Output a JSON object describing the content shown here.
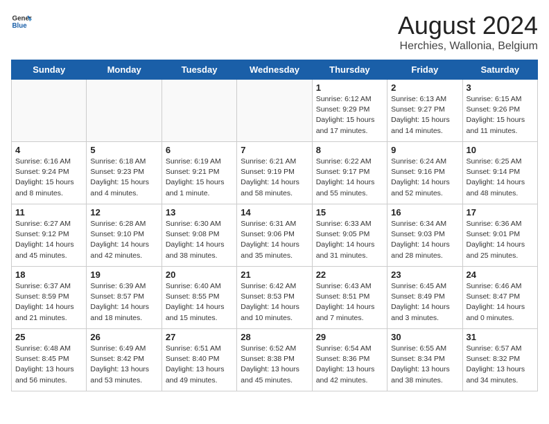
{
  "header": {
    "logo_line1": "General",
    "logo_line2": "Blue",
    "title": "August 2024",
    "subtitle": "Herchies, Wallonia, Belgium"
  },
  "weekdays": [
    "Sunday",
    "Monday",
    "Tuesday",
    "Wednesday",
    "Thursday",
    "Friday",
    "Saturday"
  ],
  "weeks": [
    [
      {
        "day": "",
        "empty": true
      },
      {
        "day": "",
        "empty": true
      },
      {
        "day": "",
        "empty": true
      },
      {
        "day": "",
        "empty": true
      },
      {
        "day": "1",
        "sunrise": "6:12 AM",
        "sunset": "9:29 PM",
        "daylight": "15 hours and 17 minutes."
      },
      {
        "day": "2",
        "sunrise": "6:13 AM",
        "sunset": "9:27 PM",
        "daylight": "15 hours and 14 minutes."
      },
      {
        "day": "3",
        "sunrise": "6:15 AM",
        "sunset": "9:26 PM",
        "daylight": "15 hours and 11 minutes."
      }
    ],
    [
      {
        "day": "4",
        "sunrise": "6:16 AM",
        "sunset": "9:24 PM",
        "daylight": "15 hours and 8 minutes."
      },
      {
        "day": "5",
        "sunrise": "6:18 AM",
        "sunset": "9:23 PM",
        "daylight": "15 hours and 4 minutes."
      },
      {
        "day": "6",
        "sunrise": "6:19 AM",
        "sunset": "9:21 PM",
        "daylight": "15 hours and 1 minute."
      },
      {
        "day": "7",
        "sunrise": "6:21 AM",
        "sunset": "9:19 PM",
        "daylight": "14 hours and 58 minutes."
      },
      {
        "day": "8",
        "sunrise": "6:22 AM",
        "sunset": "9:17 PM",
        "daylight": "14 hours and 55 minutes."
      },
      {
        "day": "9",
        "sunrise": "6:24 AM",
        "sunset": "9:16 PM",
        "daylight": "14 hours and 52 minutes."
      },
      {
        "day": "10",
        "sunrise": "6:25 AM",
        "sunset": "9:14 PM",
        "daylight": "14 hours and 48 minutes."
      }
    ],
    [
      {
        "day": "11",
        "sunrise": "6:27 AM",
        "sunset": "9:12 PM",
        "daylight": "14 hours and 45 minutes."
      },
      {
        "day": "12",
        "sunrise": "6:28 AM",
        "sunset": "9:10 PM",
        "daylight": "14 hours and 42 minutes."
      },
      {
        "day": "13",
        "sunrise": "6:30 AM",
        "sunset": "9:08 PM",
        "daylight": "14 hours and 38 minutes."
      },
      {
        "day": "14",
        "sunrise": "6:31 AM",
        "sunset": "9:06 PM",
        "daylight": "14 hours and 35 minutes."
      },
      {
        "day": "15",
        "sunrise": "6:33 AM",
        "sunset": "9:05 PM",
        "daylight": "14 hours and 31 minutes."
      },
      {
        "day": "16",
        "sunrise": "6:34 AM",
        "sunset": "9:03 PM",
        "daylight": "14 hours and 28 minutes."
      },
      {
        "day": "17",
        "sunrise": "6:36 AM",
        "sunset": "9:01 PM",
        "daylight": "14 hours and 25 minutes."
      }
    ],
    [
      {
        "day": "18",
        "sunrise": "6:37 AM",
        "sunset": "8:59 PM",
        "daylight": "14 hours and 21 minutes."
      },
      {
        "day": "19",
        "sunrise": "6:39 AM",
        "sunset": "8:57 PM",
        "daylight": "14 hours and 18 minutes."
      },
      {
        "day": "20",
        "sunrise": "6:40 AM",
        "sunset": "8:55 PM",
        "daylight": "14 hours and 15 minutes."
      },
      {
        "day": "21",
        "sunrise": "6:42 AM",
        "sunset": "8:53 PM",
        "daylight": "14 hours and 10 minutes."
      },
      {
        "day": "22",
        "sunrise": "6:43 AM",
        "sunset": "8:51 PM",
        "daylight": "14 hours and 7 minutes."
      },
      {
        "day": "23",
        "sunrise": "6:45 AM",
        "sunset": "8:49 PM",
        "daylight": "14 hours and 3 minutes."
      },
      {
        "day": "24",
        "sunrise": "6:46 AM",
        "sunset": "8:47 PM",
        "daylight": "14 hours and 0 minutes."
      }
    ],
    [
      {
        "day": "25",
        "sunrise": "6:48 AM",
        "sunset": "8:45 PM",
        "daylight": "13 hours and 56 minutes."
      },
      {
        "day": "26",
        "sunrise": "6:49 AM",
        "sunset": "8:42 PM",
        "daylight": "13 hours and 53 minutes."
      },
      {
        "day": "27",
        "sunrise": "6:51 AM",
        "sunset": "8:40 PM",
        "daylight": "13 hours and 49 minutes."
      },
      {
        "day": "28",
        "sunrise": "6:52 AM",
        "sunset": "8:38 PM",
        "daylight": "13 hours and 45 minutes."
      },
      {
        "day": "29",
        "sunrise": "6:54 AM",
        "sunset": "8:36 PM",
        "daylight": "13 hours and 42 minutes."
      },
      {
        "day": "30",
        "sunrise": "6:55 AM",
        "sunset": "8:34 PM",
        "daylight": "13 hours and 38 minutes."
      },
      {
        "day": "31",
        "sunrise": "6:57 AM",
        "sunset": "8:32 PM",
        "daylight": "13 hours and 34 minutes."
      }
    ]
  ]
}
